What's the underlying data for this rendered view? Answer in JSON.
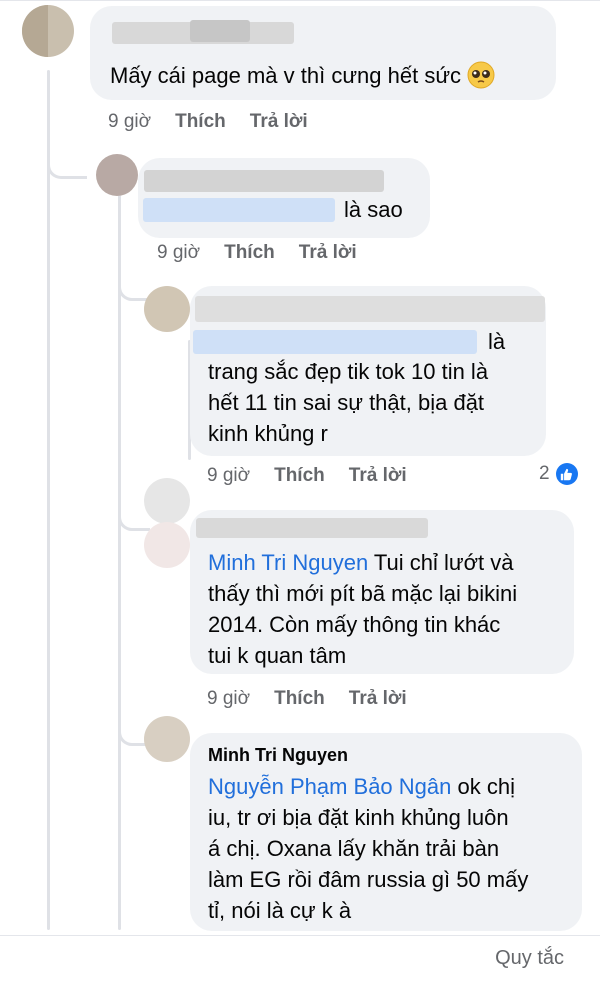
{
  "comments": [
    {
      "id": "c1",
      "text": "Mấy cái page mà v thì cưng hết sức",
      "emoji": "pleading-face",
      "time": "9 giờ",
      "like_label": "Thích",
      "reply_label": "Trả lời"
    },
    {
      "id": "c2",
      "text": "là sao",
      "time": "9 giờ",
      "like_label": "Thích",
      "reply_label": "Trả lời"
    },
    {
      "id": "c3",
      "lines": [
        "là",
        "trang sắc đẹp tik tok 10 tin là",
        "hết 11 tin sai sự thật, bịa đặt",
        "kinh khủng r"
      ],
      "time": "9 giờ",
      "like_label": "Thích",
      "reply_label": "Trả lời",
      "reaction_count": "2"
    },
    {
      "id": "c4",
      "mention": "Minh Tri Nguyen",
      "lines": [
        "Tui chỉ lướt và",
        "thấy thì mới pít bã mặc lại bikini",
        "2014. Còn mấy thông tin khác",
        "tui k quan tâm"
      ],
      "time": "9 giờ",
      "like_label": "Thích",
      "reply_label": "Trả lời"
    },
    {
      "id": "c5",
      "author": "Minh Tri Nguyen",
      "mention": "Nguyễn Phạm Bảo Ngân",
      "lines": [
        "ok chị",
        "iu, tr ơi bịa đặt kinh khủng luôn",
        "á chị. Oxana lấy khăn trải bàn",
        "làm EG rồi đâm russia gì 50 mấy",
        "tỉ, nói là cự k à"
      ]
    }
  ],
  "footer": {
    "rules_label": "Quy tắc"
  },
  "colors": {
    "bubble": "#f0f2f5",
    "link": "#216fdb",
    "muted": "#65676b",
    "like": "#1877f2"
  }
}
